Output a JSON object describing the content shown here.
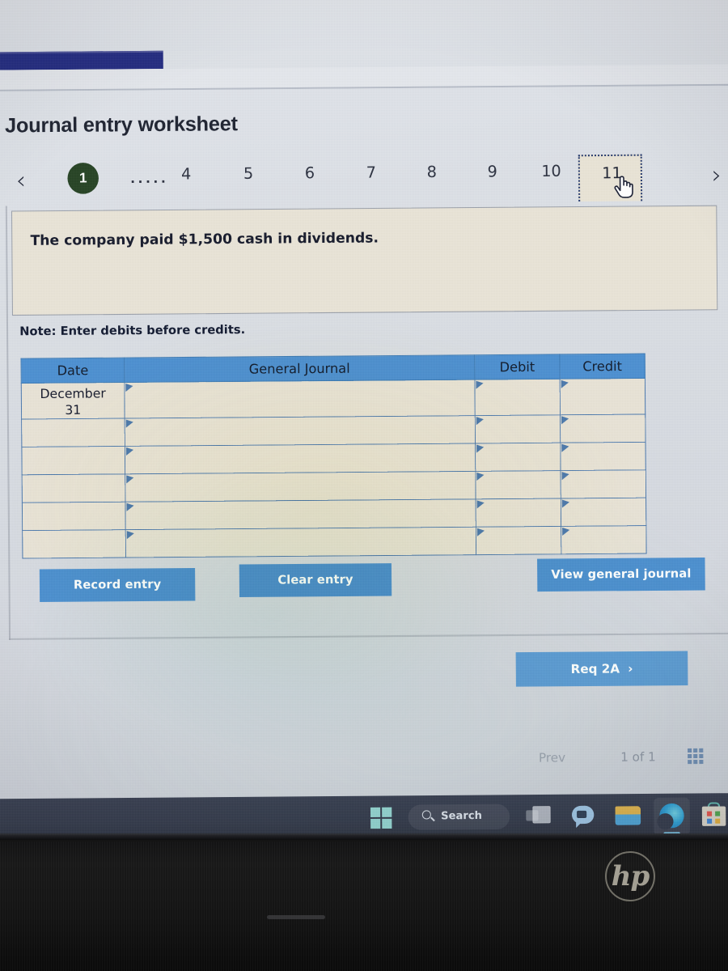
{
  "window": {
    "title_bar_visible": false
  },
  "worksheet": {
    "title": "Journal entry worksheet",
    "prompt": "The company paid $1,500 cash in dividends.",
    "note": "Note: Enter debits before credits."
  },
  "tabs": {
    "prev_arrow": "‹",
    "next_arrow": "›",
    "first": "1",
    "ellipsis": "·····",
    "items": [
      "4",
      "5",
      "6",
      "7",
      "8",
      "9",
      "10"
    ],
    "active": "11",
    "cursor_icon": "hand-pointer-icon"
  },
  "table": {
    "headers": [
      "Date",
      "General Journal",
      "Debit",
      "Credit"
    ],
    "rows": [
      {
        "date": "December\n31",
        "general_journal": "",
        "debit": "",
        "credit": ""
      },
      {
        "date": "",
        "general_journal": "",
        "debit": "",
        "credit": ""
      },
      {
        "date": "",
        "general_journal": "",
        "debit": "",
        "credit": ""
      },
      {
        "date": "",
        "general_journal": "",
        "debit": "",
        "credit": ""
      },
      {
        "date": "",
        "general_journal": "",
        "debit": "",
        "credit": ""
      },
      {
        "date": "",
        "general_journal": "",
        "debit": "",
        "credit": ""
      }
    ],
    "date_line1": "December",
    "date_line2": "31"
  },
  "buttons": {
    "record_entry": "Record entry",
    "clear_entry": "Clear entry",
    "view_general_journal": "View general journal",
    "req_2a": "Req 2A",
    "req_2a_chevron": "›"
  },
  "pager": {
    "prev": "Prev",
    "count": "1 of 1",
    "grid_icon": "grid-icon"
  },
  "taskbar": {
    "start_icon": "windows-start-icon",
    "search_placeholder": "Search",
    "search_icon": "search-icon",
    "task_view_icon": "task-view-icon",
    "chat_icon": "chat-icon",
    "file_explorer_icon": "file-explorer-icon",
    "edge_icon": "microsoft-edge-icon",
    "store_icon": "microsoft-store-icon"
  },
  "device": {
    "brand": "hp"
  },
  "colors": {
    "table_header_blue": "#4b8fd1",
    "button_blue": "#4a8fcf",
    "cell_beige": "#e8e3d6",
    "active_tab_circle_green": "#254223",
    "top_strip_navy": "#222a80"
  }
}
